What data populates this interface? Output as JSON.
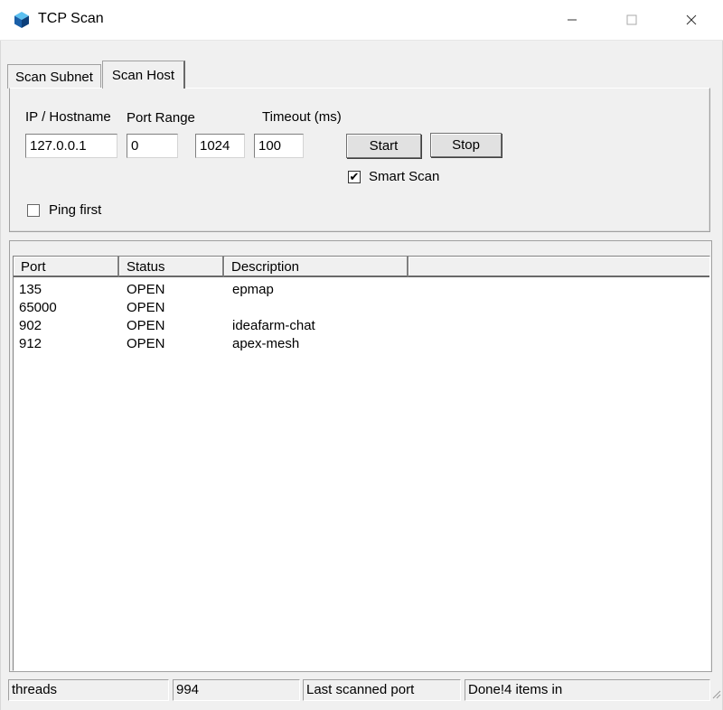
{
  "window": {
    "title": "TCP Scan"
  },
  "tabs": [
    {
      "label": "Scan Subnet"
    },
    {
      "label": "Scan Host"
    }
  ],
  "form": {
    "ip_label": "IP / Hostname",
    "ip_value": "127.0.0.1",
    "port_range_label": "Port Range",
    "port_from": "0",
    "port_to": "1024",
    "timeout_label": "Timeout (ms)",
    "timeout_value": "100",
    "start_label": "Start",
    "stop_label": "Stop",
    "smart_scan_label": "Smart Scan",
    "smart_scan_checked": true,
    "ping_first_label": "Ping first",
    "ping_first_checked": false
  },
  "results": {
    "columns": [
      "Port",
      "Status",
      "Description"
    ],
    "rows": [
      {
        "port": "135",
        "status": "OPEN",
        "description": "epmap"
      },
      {
        "port": "65000",
        "status": "OPEN",
        "description": ""
      },
      {
        "port": "902",
        "status": "OPEN",
        "description": "ideafarm-chat"
      },
      {
        "port": "912",
        "status": "OPEN",
        "description": "apex-mesh"
      }
    ]
  },
  "statusbar": {
    "threads": "threads",
    "count": "994",
    "last_scanned": "Last scanned port",
    "done": "Done!4 items in"
  }
}
